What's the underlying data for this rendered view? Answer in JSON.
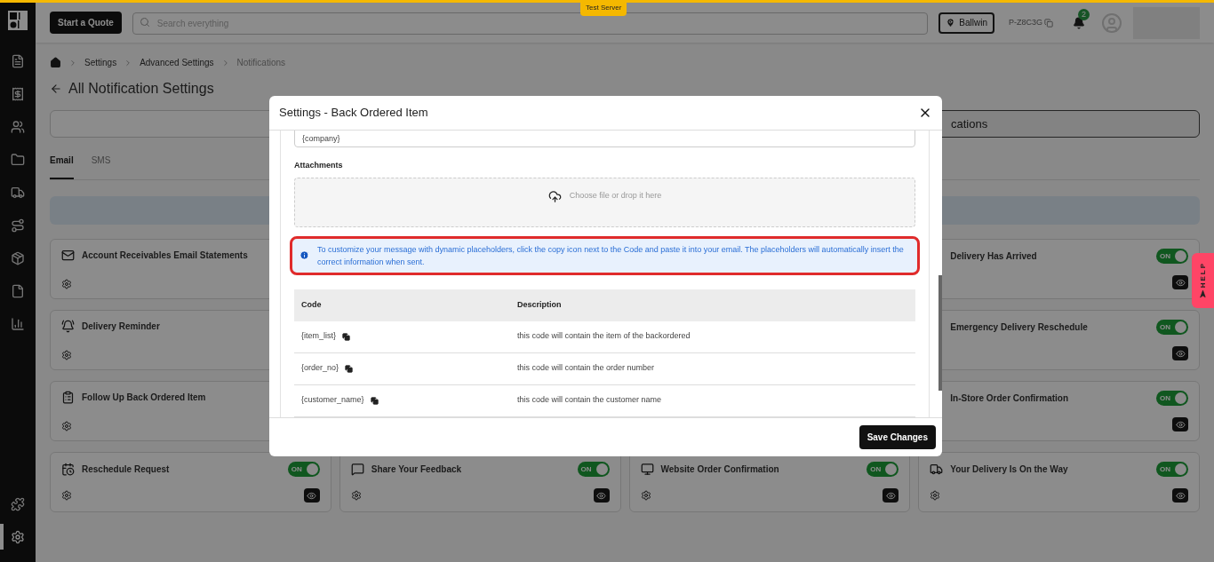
{
  "top_bar": {
    "quote_button": "Start a Quote",
    "search": {
      "placeholder": "Search everything"
    },
    "server_tag": "Test Server",
    "location": "Ballwin",
    "store_code": "P-Z8C3G",
    "notification_count": "2"
  },
  "sidebar": {
    "items": [
      {
        "kind": "quote",
        "selected": false
      },
      {
        "kind": "ledger",
        "selected": false
      },
      {
        "kind": "users",
        "selected": false
      },
      {
        "kind": "folder",
        "selected": false
      },
      {
        "kind": "truck",
        "selected": false
      },
      {
        "kind": "route",
        "selected": false
      },
      {
        "kind": "package",
        "selected": false
      },
      {
        "kind": "document",
        "selected": false
      },
      {
        "kind": "chart",
        "selected": false
      }
    ],
    "bottom_items": [
      {
        "kind": "puzzle",
        "selected": false
      },
      {
        "kind": "settings",
        "selected": true
      }
    ]
  },
  "breadcrumb": [
    "Settings",
    "Advanced Settings",
    "Notifications"
  ],
  "page_title": "All Notification Settings",
  "segment_label": "cations",
  "channel_tabs": [
    {
      "label": "Email",
      "selected": true
    },
    {
      "label": "SMS",
      "selected": false
    }
  ],
  "card_columns": [
    [
      {
        "kind": "left",
        "title": "Account Receivables Email Statements"
      },
      {
        "kind": "left",
        "title": "Delivery Reminder"
      },
      {
        "kind": "left",
        "title": "Follow Up Back Ordered Item"
      },
      {
        "kind": "full",
        "title": "Reschedule Request",
        "on": true,
        "toggle_text": "ON"
      }
    ],
    [
      {
        "kind": "full",
        "title": "Share Your Feedback",
        "on": true,
        "toggle_text": "ON"
      }
    ],
    [
      {
        "kind": "full",
        "title": "Website Order Confirmation",
        "on": true,
        "toggle_text": "ON"
      }
    ],
    [
      {
        "kind": "right",
        "title": "Delivery Has Arrived",
        "on": true,
        "toggle_text": "ON"
      },
      {
        "kind": "right",
        "title": "Emergency Delivery Reschedule",
        "on": true,
        "toggle_text": "ON"
      },
      {
        "kind": "right",
        "title": "In-Store Order Confirmation",
        "on": true,
        "toggle_text": "ON"
      },
      {
        "kind": "full",
        "title": "Your Delivery Is On the Way",
        "on": true,
        "toggle_text": "ON"
      }
    ]
  ],
  "help_tab": "HELP",
  "modal": {
    "title": "Settings - Back Ordered Item",
    "field_value": "{company}",
    "attachments_label": "Attachments",
    "dropzone_text": "Choose file or drop it here",
    "info": "To customize your message with dynamic placeholders, click the copy icon next to the Code and paste it into your email. The placeholders will automatically insert the correct information when sent.",
    "table": {
      "columns": [
        "Code",
        "Description"
      ],
      "rows": [
        {
          "code": "{item_list}",
          "description": "this code will contain the item of the backordered"
        },
        {
          "code": "{order_no}",
          "description": "this code will contain the order number"
        },
        {
          "code": "{customer_name}",
          "description": "this code will contain the customer name"
        }
      ]
    },
    "save_button": "Save Changes"
  }
}
